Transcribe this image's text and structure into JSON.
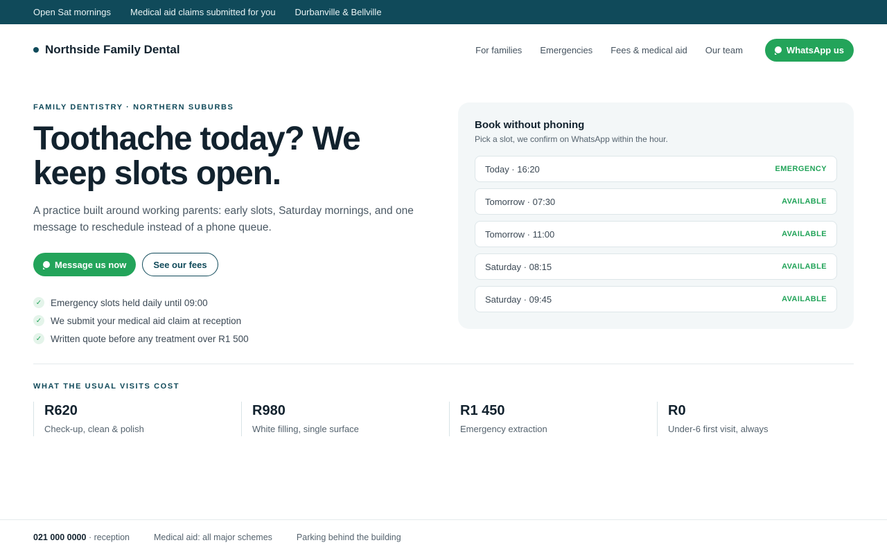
{
  "topbar": {
    "items": [
      "Open Sat mornings",
      "Medical aid claims submitted for you",
      "Durbanville & Bellville"
    ]
  },
  "header": {
    "brand": "Northside Family Dental",
    "nav": [
      "For families",
      "Emergencies",
      "Fees & medical aid",
      "Our team"
    ],
    "whatsapp_label": "WhatsApp us"
  },
  "hero": {
    "eyebrow": "FAMILY DENTISTRY · NORTHERN SUBURBS",
    "title": "Toothache today? We keep slots open.",
    "subtitle": "A practice built around working parents: early slots, Saturday mornings, and one message to reschedule instead of a phone queue.",
    "cta_primary": "Message us now",
    "cta_secondary": "See our fees",
    "checks": [
      "Emergency slots held daily until 09:00",
      "We submit your medical aid claim at reception",
      "Written quote before any treatment over R1 500"
    ],
    "check_mark": "✓"
  },
  "booking": {
    "title": "Book without phoning",
    "subtitle": "Pick a slot, we confirm on WhatsApp within the hour.",
    "slots": [
      {
        "time": "Today · 16:20",
        "status": "EMERGENCY"
      },
      {
        "time": "Tomorrow · 07:30",
        "status": "AVAILABLE"
      },
      {
        "time": "Tomorrow · 11:00",
        "status": "AVAILABLE"
      },
      {
        "time": "Saturday · 08:15",
        "status": "AVAILABLE"
      },
      {
        "time": "Saturday · 09:45",
        "status": "AVAILABLE"
      }
    ]
  },
  "costs": {
    "label": "WHAT THE USUAL VISITS COST",
    "items": [
      {
        "price": "R620",
        "desc": "Check-up, clean & polish"
      },
      {
        "price": "R980",
        "desc": "White filling, single surface"
      },
      {
        "price": "R1 450",
        "desc": "Emergency extraction"
      },
      {
        "price": "R0",
        "desc": "Under-6 first visit, always"
      }
    ]
  },
  "footer": {
    "phone": "021 000 0000",
    "phone_suffix": " · reception",
    "medical_aid": "Medical aid: all major schemes",
    "parking": "Parking behind the building"
  },
  "colors": {
    "brand": "#104a5a",
    "accent": "#23a45a",
    "card_bg": "#f3f7f8"
  }
}
